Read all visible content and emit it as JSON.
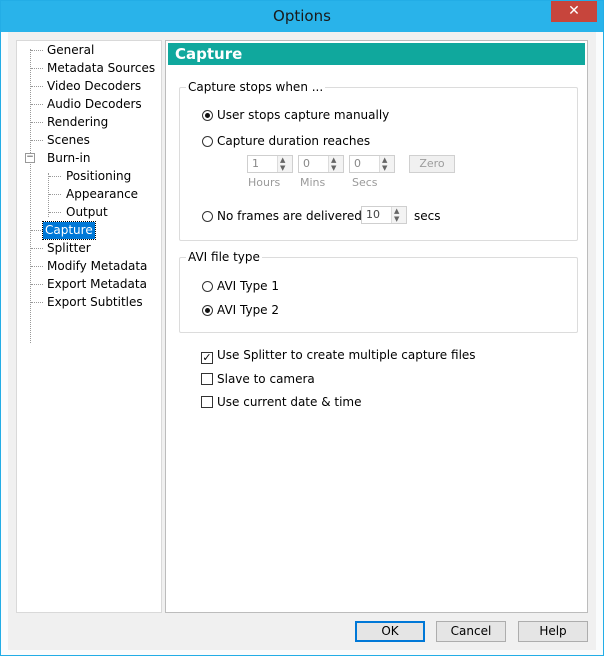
{
  "window": {
    "title": "Options",
    "close_glyph": "✕"
  },
  "tree": {
    "items": [
      {
        "label": "General",
        "selected": false
      },
      {
        "label": "Metadata Sources",
        "selected": false
      },
      {
        "label": "Video Decoders",
        "selected": false
      },
      {
        "label": "Audio Decoders",
        "selected": false
      },
      {
        "label": "Rendering",
        "selected": false
      },
      {
        "label": "Scenes",
        "selected": false
      },
      {
        "label": "Burn-in",
        "selected": false,
        "expanded": true
      },
      {
        "label": "Positioning",
        "selected": false,
        "child": true
      },
      {
        "label": "Appearance",
        "selected": false,
        "child": true
      },
      {
        "label": "Output",
        "selected": false,
        "child": true
      },
      {
        "label": "Capture",
        "selected": true
      },
      {
        "label": "Splitter",
        "selected": false
      },
      {
        "label": "Modify Metadata",
        "selected": false
      },
      {
        "label": "Export Metadata",
        "selected": false
      },
      {
        "label": "Export Subtitles",
        "selected": false
      }
    ],
    "collapse_glyph": "−"
  },
  "panel": {
    "title": "Capture",
    "header_color": "#10a89d",
    "stops_group": {
      "label": "Capture stops when ...",
      "opt_manual": "User stops capture manually",
      "opt_duration": "Capture duration reaches",
      "hours_value": "1",
      "mins_value": "0",
      "secs_value": "0",
      "hours_label": "Hours",
      "mins_label": "Mins",
      "secs_label": "Secs",
      "zero_label": "Zero",
      "opt_noframes": "No frames are delivered for",
      "noframes_value": "10",
      "noframes_unit": "secs",
      "selected": "manual"
    },
    "avi_group": {
      "label": "AVI file type",
      "opt_type1": "AVI Type 1",
      "opt_type2": "AVI Type 2",
      "selected": "type2"
    },
    "checks": {
      "splitter": "Use Splitter to create multiple capture files",
      "splitter_checked": true,
      "slave": "Slave to camera",
      "slave_checked": false,
      "datetime": "Use current date & time",
      "datetime_checked": false
    }
  },
  "buttons": {
    "ok": "OK",
    "cancel": "Cancel",
    "help": "Help"
  },
  "glyphs": {
    "check": "✓",
    "up": "▲",
    "down": "▼"
  }
}
